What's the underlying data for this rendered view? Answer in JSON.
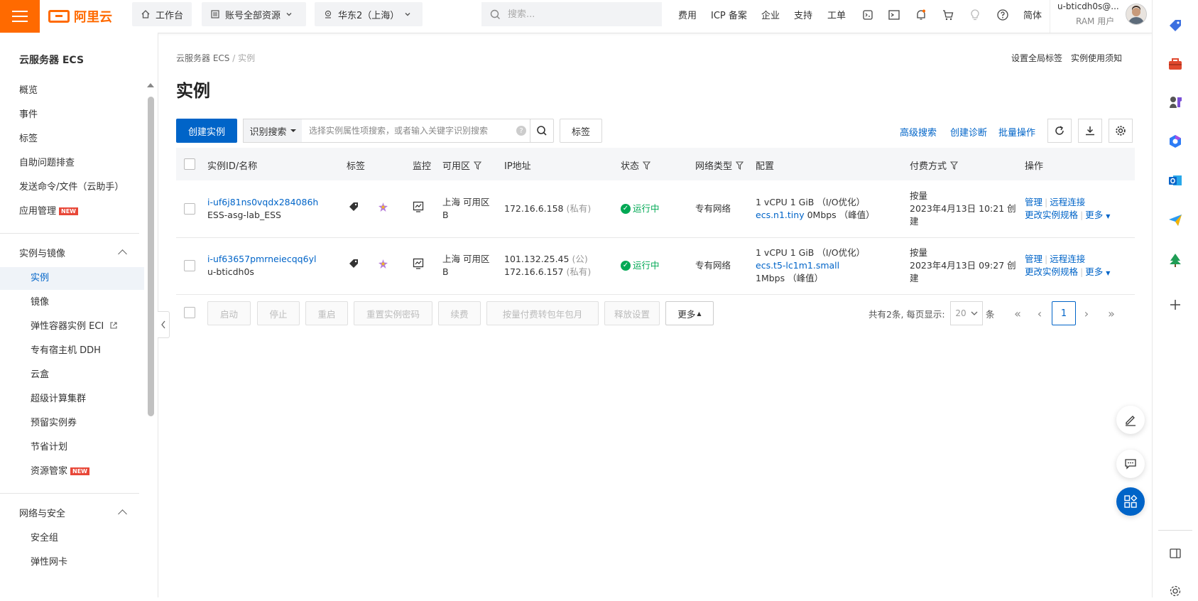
{
  "topbar": {
    "logo_text": "阿里云",
    "workbench": "工作台",
    "resources": "账号全部资源",
    "region": "华东2（上海）",
    "search_placeholder": "搜索...",
    "links": [
      "费用",
      "ICP 备案",
      "企业",
      "支持",
      "工单"
    ],
    "lang": "简体",
    "user_name": "u-bticdh0s@...",
    "user_role": "RAM 用户"
  },
  "sidebar": {
    "title": "云服务器 ECS",
    "top_items": [
      "概览",
      "事件",
      "标签",
      "自助问题排查",
      "发送命令/文件（云助手）",
      "应用管理"
    ],
    "new_badge": "NEW",
    "group1": "实例与镜像",
    "group1_items": [
      "实例",
      "镜像",
      "弹性容器实例 ECI",
      "专有宿主机 DDH",
      "云盒",
      "超级计算集群",
      "预留实例券",
      "节省计划",
      "资源管家"
    ],
    "group2": "网络与安全",
    "group2_items": [
      "安全组",
      "弹性网卡"
    ]
  },
  "main": {
    "breadcrumb_root": "云服务器 ECS",
    "breadcrumb_sep": "/",
    "breadcrumb_current": "实例",
    "title": "实例",
    "top_links": [
      "设置全局标签",
      "实例使用须知"
    ],
    "create_button": "创建实例",
    "search_type": "识别搜索",
    "search_placeholder": "选择实例属性项搜索，或者输入关键字识别搜索",
    "tag_button": "标签",
    "tool_links": [
      "高级搜索",
      "创建诊断",
      "批量操作"
    ]
  },
  "table": {
    "headers": {
      "id": "实例ID/名称",
      "tag": "标签",
      "monitor": "监控",
      "zone": "可用区",
      "ip": "IP地址",
      "status": "状态",
      "network": "网络类型",
      "config": "配置",
      "billing": "付费方式",
      "ops": "操作"
    },
    "rows": [
      {
        "id": "i-uf6j81ns0vqdx284086h",
        "name": "ESS-asg-lab_ESS",
        "zone_line1": "上海 可用区",
        "zone_line2": "B",
        "ip1": "172.16.6.158",
        "ip1_type": "(私有)",
        "ip2": "",
        "ip2_type": "",
        "status": "运行中",
        "network": "专有网络",
        "config_line1": "1 vCPU 1 GiB （I/O优化）",
        "config_type": "ecs.n1.tiny",
        "config_bw": "0Mbps （峰值）",
        "billing_line1": "按量",
        "billing_line2": "2023年4月13日 10:21 创",
        "billing_line3": "建",
        "op_manage": "管理",
        "op_remote": "远程连接",
        "op_change": "更改实例规格",
        "op_more": "更多"
      },
      {
        "id": "i-uf63657pmrneiecqq6yl",
        "name": "u-bticdh0s",
        "zone_line1": "上海 可用区",
        "zone_line2": "B",
        "ip1": "101.132.25.45",
        "ip1_type": "(公)",
        "ip2": "172.16.6.157",
        "ip2_type": "(私有)",
        "status": "运行中",
        "network": "专有网络",
        "config_line1": "1 vCPU 1 GiB （I/O优化）",
        "config_type": "ecs.t5-lc1m1.small",
        "config_bw": "1Mbps （峰值）",
        "billing_line1": "按量",
        "billing_line2": "2023年4月13日 09:27 创",
        "billing_line3": "建",
        "op_manage": "管理",
        "op_remote": "远程连接",
        "op_change": "更改实例规格",
        "op_more": "更多"
      }
    ]
  },
  "bulk_actions": [
    "启动",
    "停止",
    "重启",
    "重置实例密码",
    "续费",
    "按量付费转包年包月",
    "释放设置"
  ],
  "more_button": "更多",
  "pager": {
    "info": "共有2条, 每页显示:",
    "page_size": "20",
    "unit": "条",
    "current": "1"
  },
  "colors": {
    "brand": "#ff6a00",
    "primary": "#0064c8",
    "success": "#00a854"
  }
}
